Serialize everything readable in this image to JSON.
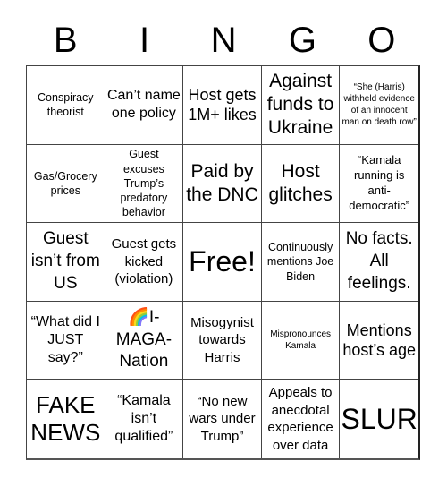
{
  "header": {
    "letters": [
      "B",
      "I",
      "N",
      "G",
      "O"
    ]
  },
  "cells": [
    {
      "text": "Conspiracy theorist"
    },
    {
      "text": "Can’t name one policy"
    },
    {
      "text": "Host gets 1M+ likes"
    },
    {
      "text": "Against funds to Ukraine"
    },
    {
      "text": "“She (Harris) withheld evidence of an innocent man on death row”"
    },
    {
      "text": "Gas/Grocery prices"
    },
    {
      "text": "Guest excuses Trump’s predatory behavior"
    },
    {
      "text": "Paid by the DNC"
    },
    {
      "text": "Host glitches"
    },
    {
      "text": "“Kamala running is anti-democratic”"
    },
    {
      "text": "Guest isn’t from US"
    },
    {
      "text": "Guest gets kicked (violation)"
    },
    {
      "text": "Free!"
    },
    {
      "text": "Continuously mentions Joe Biden"
    },
    {
      "text": "No facts. All feelings."
    },
    {
      "text": "“What did I JUST say?”"
    },
    {
      "text": "🌈I-MAGA-Nation"
    },
    {
      "text": "Misogynist towards Harris"
    },
    {
      "text": "Mispronounces Kamala"
    },
    {
      "text": "Mentions host’s age"
    },
    {
      "text": "FAKE NEWS"
    },
    {
      "text": "“Kamala isn’t qualified”"
    },
    {
      "text": "“No new wars under Trump”"
    },
    {
      "text": "Appeals to anecdotal experience over data"
    },
    {
      "text": "SLUR"
    }
  ]
}
